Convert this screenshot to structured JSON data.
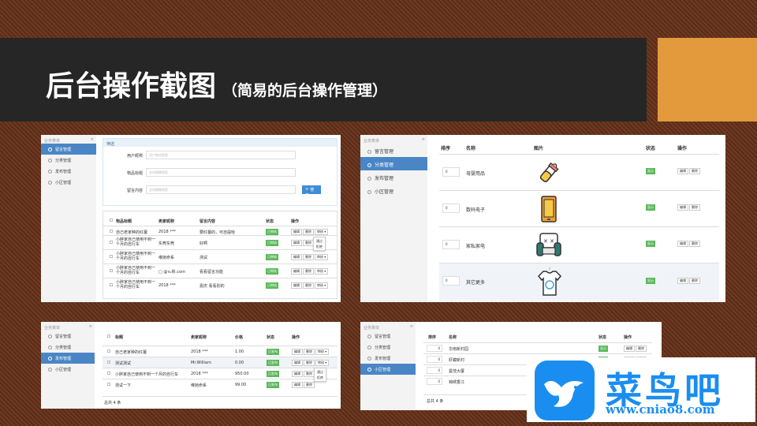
{
  "header": {
    "title": "后台操作截图",
    "subtitle": "（简易的后台操作管理）"
  },
  "sidebar_title": "业务菜单",
  "sidebar_items": [
    "留言管理",
    "分类管理",
    "发布管理",
    "小区管理"
  ],
  "panel1": {
    "filter_title": "筛选",
    "fields": [
      {
        "label": "用户昵称",
        "placeholder": "用户微信昵称"
      },
      {
        "label": "物品标题",
        "placeholder": "支持模糊搜索"
      },
      {
        "label": "留言内容",
        "placeholder": "支持模糊搜索"
      }
    ],
    "search_btn": "搜索",
    "headers": [
      "物品标题",
      "卖家昵称",
      "留言内容",
      "状态",
      "操作"
    ],
    "rows": [
      {
        "title": "自己老家种的红薯",
        "seller": "2018 ***",
        "content": "要红薯的，可自提哈",
        "status": "已审核"
      },
      {
        "title": "小胖家自己使用不到一个月的自行车",
        "seller": "东莞东莞",
        "content": "好啊",
        "status": "已审核"
      },
      {
        "title": "小胖家自己使用不到一个月的自行车",
        "seller": "维她命系",
        "content": "测试",
        "status": "已审核"
      },
      {
        "title": "小胖家自己使用不到一个月的自行车",
        "seller": "□ @℡彬.com",
        "content": "看看留言功能",
        "status": "已审核"
      },
      {
        "title": "小胖家自己使用不到一个月的自行车",
        "seller": "2018 ***",
        "content": "嘉庆 看看别的",
        "status": "已审核"
      }
    ],
    "actions": [
      "编辑",
      "删除",
      "审核 ▾"
    ],
    "dropdown": [
      "通过",
      "拒绝"
    ]
  },
  "panel2": {
    "headers": [
      "排序",
      "名称",
      "图片",
      "状态",
      "操作"
    ],
    "rows": [
      {
        "order": "0",
        "name": "母婴用品",
        "status": "显示"
      },
      {
        "order": "0",
        "name": "数码电子",
        "status": "显示"
      },
      {
        "order": "0",
        "name": "家私家电",
        "status": "显示"
      },
      {
        "order": "0",
        "name": "其它更多",
        "status": "显示"
      }
    ],
    "actions": [
      "编辑",
      "删除"
    ]
  },
  "panel3": {
    "headers": [
      "标题",
      "卖家昵称",
      "价格",
      "状态",
      "操作"
    ],
    "rows": [
      {
        "title": "自己老家种的红薯",
        "seller": "2018 ***",
        "price": "1.00",
        "status": "已发布"
      },
      {
        "title": "测试测试",
        "seller": "Mr.William",
        "price": "0.00",
        "status": "已发布"
      },
      {
        "title": "小胖家自己使用不到一个月的自行车",
        "seller": "2018 ***",
        "price": "950.00",
        "status": "已发布"
      },
      {
        "title": "测试一下",
        "seller": "维她命系",
        "price": "99.00",
        "status": "已发布"
      }
    ],
    "actions": [
      "编辑",
      "删除",
      "审核 ▾"
    ],
    "dropdown": [
      "通过",
      "拒绝"
    ],
    "footer": "总共 4 条"
  },
  "panel4": {
    "headers": [
      "排序",
      "名称",
      "状态",
      "操作"
    ],
    "rows": [
      {
        "order": "0",
        "name": "华南新村园",
        "status": "显示"
      },
      {
        "order": "0",
        "name": "虾蟆新村",
        "status": "显示"
      },
      {
        "order": "0",
        "name": "曼茂大厦",
        "status": "显示"
      },
      {
        "order": "0",
        "name": "锦绣香江",
        "status": "显示"
      }
    ],
    "actions": [
      "编辑",
      "删除"
    ],
    "footer": "总共 4 条"
  },
  "logo": {
    "name": "菜鸟吧",
    "url": "www.cniao8.com"
  }
}
